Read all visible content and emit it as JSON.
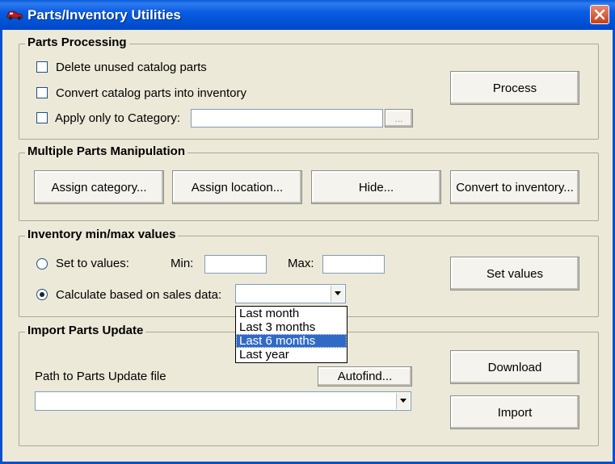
{
  "window": {
    "title": "Parts/Inventory Utilities",
    "icon": "car-icon",
    "close_icon": "close-icon"
  },
  "parts_processing": {
    "title": "Parts Processing",
    "delete_unused_label": "Delete unused catalog parts",
    "convert_label": "Convert catalog parts into inventory",
    "apply_category_label": "Apply only to Category:",
    "category_value": "",
    "browse_label": "...",
    "process_button": "Process"
  },
  "multiple_parts": {
    "title": "Multiple Parts Manipulation",
    "assign_category": "Assign category...",
    "assign_location": "Assign location...",
    "hide": "Hide...",
    "convert_inventory": "Convert to inventory..."
  },
  "inventory_minmax": {
    "title": "Inventory min/max values",
    "set_to_values_label": "Set to values:",
    "min_label": "Min:",
    "min_value": "",
    "max_label": "Max:",
    "max_value": "",
    "calculate_label": "Calculate based on sales data:",
    "period_value": "",
    "period_options": [
      "Last month",
      "Last 3 months",
      "Last 6 months",
      "Last year"
    ],
    "highlighted_option": "Last 6 months",
    "set_values_button": "Set values"
  },
  "import_update": {
    "title": "Import Parts Update",
    "path_label": "Path to Parts Update file",
    "autofind_button": "Autofind...",
    "path_value": "",
    "download_button": "Download",
    "import_button": "Import"
  }
}
